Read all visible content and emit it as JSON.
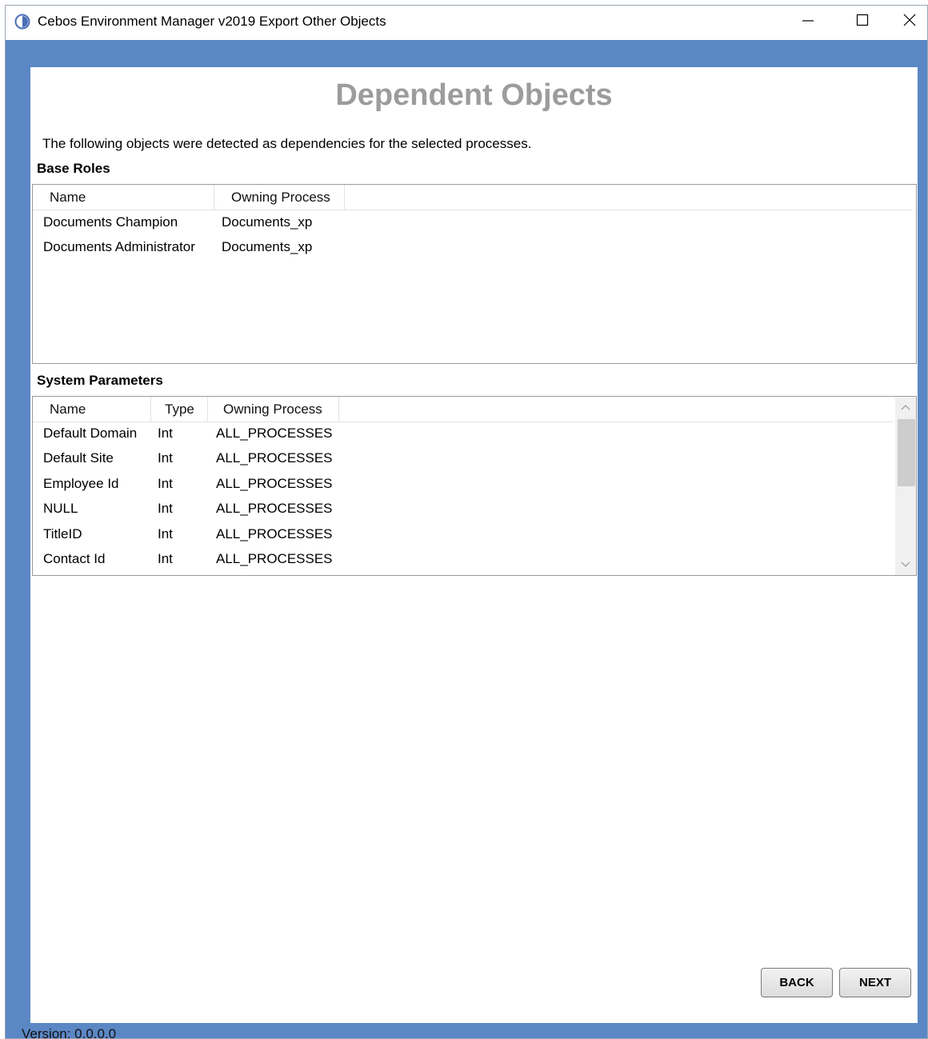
{
  "window": {
    "title": "Cebos Environment Manager v2019 Export Other Objects",
    "controls": [
      "minimize-icon",
      "maximize-icon",
      "close-icon"
    ]
  },
  "page": {
    "title": "Dependent Objects",
    "intro": "The following objects were detected as dependencies for the selected processes."
  },
  "base_roles": {
    "label": "Base Roles",
    "columns": [
      "Name",
      "Owning Process"
    ],
    "rows": [
      [
        "Documents Champion",
        "Documents_xp"
      ],
      [
        "Documents Administrator",
        "Documents_xp"
      ]
    ]
  },
  "system_parameters": {
    "label": "System Parameters",
    "columns": [
      "Name",
      "Type",
      "Owning Process"
    ],
    "rows": [
      [
        "Default Domain",
        "Int",
        "ALL_PROCESSES"
      ],
      [
        "Default Site",
        "Int",
        "ALL_PROCESSES"
      ],
      [
        "Employee Id",
        "Int",
        "ALL_PROCESSES"
      ],
      [
        "NULL",
        "Int",
        "ALL_PROCESSES"
      ],
      [
        "TitleID",
        "Int",
        "ALL_PROCESSES"
      ],
      [
        "Contact Id",
        "Int",
        "ALL_PROCESSES"
      ]
    ]
  },
  "buttons": {
    "back": "BACK",
    "next": "NEXT"
  },
  "footer": {
    "version": "Version: 0.0.0.0"
  },
  "colors": {
    "frame_blue": "#5b87c5",
    "title_gray": "#9c9c9c"
  }
}
